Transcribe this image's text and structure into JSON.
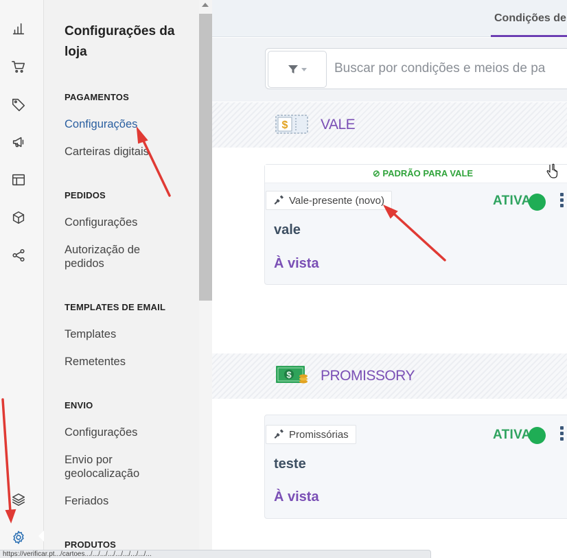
{
  "menu": {
    "title": "Configurações da loja",
    "sections": [
      {
        "title": "PAGAMENTOS",
        "items": [
          "Configurações",
          "Carteiras digitais"
        ]
      },
      {
        "title": "PEDIDOS",
        "items": [
          "Configurações",
          "Autorização de pedidos"
        ]
      },
      {
        "title": "TEMPLATES DE EMAIL",
        "items": [
          "Templates",
          "Remetentes"
        ]
      },
      {
        "title": "ENVIO",
        "items": [
          "Configurações",
          "Envio por geolocalização",
          "Feriados"
        ]
      },
      {
        "title": "PRODUTOS",
        "items": []
      }
    ],
    "active_item": "Configurações"
  },
  "rail": {
    "icons": [
      "bar-chart-icon",
      "cart-icon",
      "tag-icon",
      "megaphone-icon",
      "layout-icon",
      "box-icon",
      "share-icon",
      "layers-icon",
      "gear-icon"
    ]
  },
  "main": {
    "tab": "Condições de p",
    "search": {
      "placeholder": "Buscar por condições e meios de pa"
    },
    "groups": [
      {
        "label": "VALE",
        "icon": "voucher-icon",
        "card": {
          "default_badge": "PADRÃO PARA VALE",
          "connector": "Vale-presente (novo)",
          "status": "ATIVA",
          "name": "vale",
          "term": "À vista"
        }
      },
      {
        "label": "PROMISSORY",
        "icon": "money-icon",
        "card": {
          "connector": "Promissórias",
          "status": "ATIVA",
          "name": "teste",
          "term": "À vista"
        }
      }
    ]
  },
  "statusbar": {
    "url": "https://verificar.pt.../cartoes.../.../.../.../.../.../.../.../..."
  },
  "colors": {
    "accent": "#7a4fb5",
    "active": "#2fa35f",
    "link": "#2a5fa0"
  }
}
